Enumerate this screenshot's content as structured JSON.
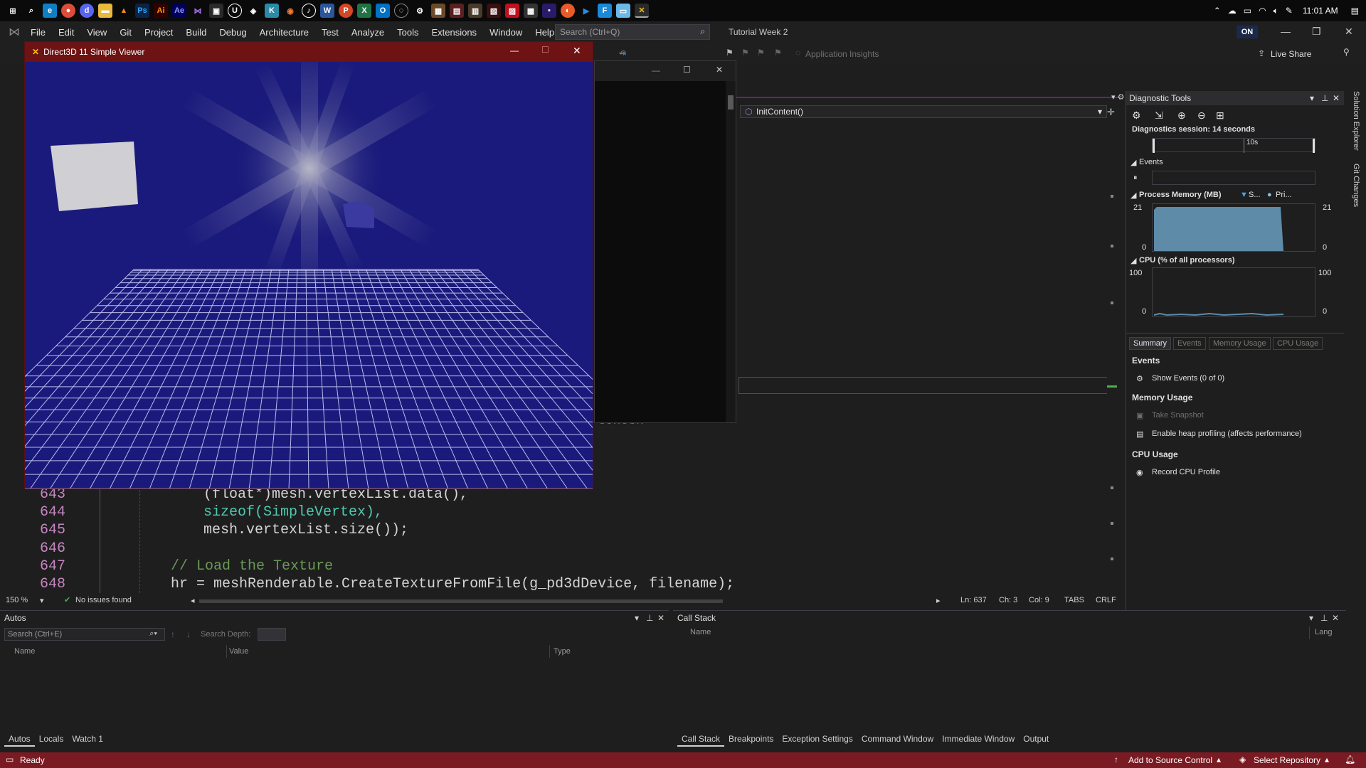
{
  "taskbar": {
    "time": "11:01 AM"
  },
  "menubar": {
    "items": [
      "File",
      "Edit",
      "View",
      "Git",
      "Project",
      "Build",
      "Debug",
      "Architecture",
      "Test",
      "Analyze",
      "Tools",
      "Extensions",
      "Window",
      "Help"
    ],
    "search_placeholder": "Search (Ctrl+Q)",
    "solution_title": "Tutorial Week 2",
    "on_badge": "ON"
  },
  "toolbar": {
    "application_insights": "Application Insights",
    "live_share": "Live Share"
  },
  "d3d_window": {
    "title": "Direct3D 11 Simple Viewer"
  },
  "editor": {
    "nav_member": "InitContent()",
    "partial_text": "tcnesn",
    "lines": [
      {
        "num": "643",
        "code": "(float*)mesh.vertexList.data(),"
      },
      {
        "num": "644",
        "code": "sizeof(SimpleVertex),"
      },
      {
        "num": "645",
        "code": "mesh.vertexList.size());"
      },
      {
        "num": "646",
        "code": ""
      },
      {
        "num": "647",
        "code": "// Load the Texture"
      },
      {
        "num": "648",
        "code": "hr = meshRenderable.CreateTextureFromFile(g_pd3dDevice, filename);"
      }
    ]
  },
  "editor_status": {
    "zoom": "150 %",
    "issues": "No issues found",
    "ln": "Ln: 637",
    "ch": "Ch: 3",
    "col": "Col: 9",
    "tabs": "TABS",
    "crlf": "CRLF"
  },
  "diagnostics": {
    "title": "Diagnostic Tools",
    "session": "Diagnostics session: 14 seconds",
    "timeline_tick": "10s",
    "events_label": "Events",
    "memory_label": "Process Memory (MB)",
    "memory_legend_1": "S...",
    "memory_legend_2": "Pri...",
    "memory_max": "21",
    "memory_min": "0",
    "cpu_label": "CPU (% of all processors)",
    "cpu_max": "100",
    "cpu_min": "0",
    "tabs": [
      "Summary",
      "Events",
      "Memory Usage",
      "CPU Usage"
    ],
    "events_section": "Events",
    "show_events": "Show Events (0 of 0)",
    "memory_section": "Memory Usage",
    "take_snapshot": "Take Snapshot",
    "heap_profiling": "Enable heap profiling (affects performance)",
    "cpu_section": "CPU Usage",
    "record_cpu": "Record CPU Profile"
  },
  "side_tabs": [
    "Solution Explorer",
    "Git Changes"
  ],
  "autos": {
    "title": "Autos",
    "search_placeholder": "Search (Ctrl+E)",
    "search_depth": "Search Depth:",
    "columns": [
      "Name",
      "Value",
      "Type"
    ],
    "tabs": [
      "Autos",
      "Locals",
      "Watch 1"
    ]
  },
  "callstack": {
    "title": "Call Stack",
    "columns": [
      "Name",
      "Lang"
    ],
    "tabs": [
      "Call Stack",
      "Breakpoints",
      "Exception Settings",
      "Command Window",
      "Immediate Window",
      "Output"
    ]
  },
  "statusbar": {
    "ready": "Ready",
    "add_source": "Add to Source Control",
    "select_repo": "Select Repository"
  },
  "colors": {
    "status_bar": "#7a1a22",
    "d3d_title": "#6d1313",
    "d3d_background": "#18187a"
  }
}
